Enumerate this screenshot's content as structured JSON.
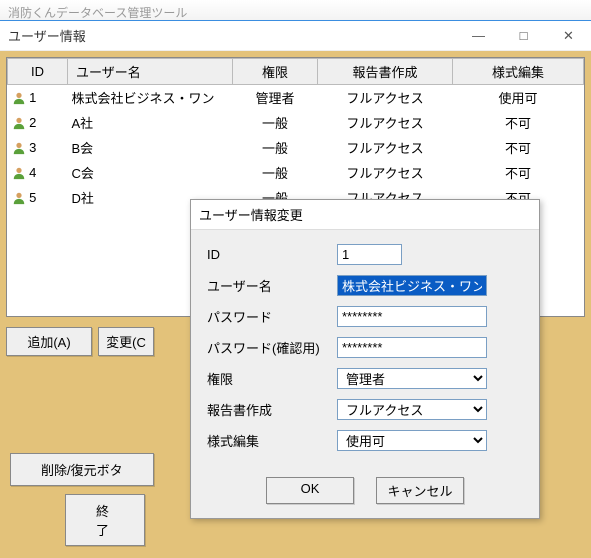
{
  "outer": {
    "title": "消防くんデータベース管理ツール"
  },
  "main": {
    "title": "ユーザー情報",
    "minimize": "—",
    "maximize": "□",
    "close": "✕"
  },
  "table": {
    "headers": {
      "id": "ID",
      "name": "ユーザー名",
      "perm": "権限",
      "report": "報告書作成",
      "form": "様式編集"
    },
    "rows": [
      {
        "id": "1",
        "name": "株式会社ビジネス・ワン",
        "perm": "管理者",
        "report": "フルアクセス",
        "form": "使用可"
      },
      {
        "id": "2",
        "name": "A社",
        "perm": "一般",
        "report": "フルアクセス",
        "form": "不可"
      },
      {
        "id": "3",
        "name": "B会",
        "perm": "一般",
        "report": "フルアクセス",
        "form": "不可"
      },
      {
        "id": "4",
        "name": "C会",
        "perm": "一般",
        "report": "フルアクセス",
        "form": "不可"
      },
      {
        "id": "5",
        "name": "D社",
        "perm": "一般",
        "report": "フルアクセス",
        "form": "不可"
      }
    ]
  },
  "buttons": {
    "add": "追加(A)",
    "change": "変更(C",
    "delete_restore": "削除/復元ボタ",
    "end": "終了"
  },
  "dialog": {
    "title": "ユーザー情報変更",
    "labels": {
      "id": "ID",
      "name": "ユーザー名",
      "pw": "パスワード",
      "pw2": "パスワード(確認用)",
      "perm": "権限",
      "report": "報告書作成",
      "form": "様式編集"
    },
    "values": {
      "id": "1",
      "name": "株式会社ビジネス・ワン",
      "pw": "********",
      "pw2": "********",
      "perm": "管理者",
      "report": "フルアクセス",
      "form": "使用可"
    },
    "ok": "OK",
    "cancel": "キャンセル"
  }
}
